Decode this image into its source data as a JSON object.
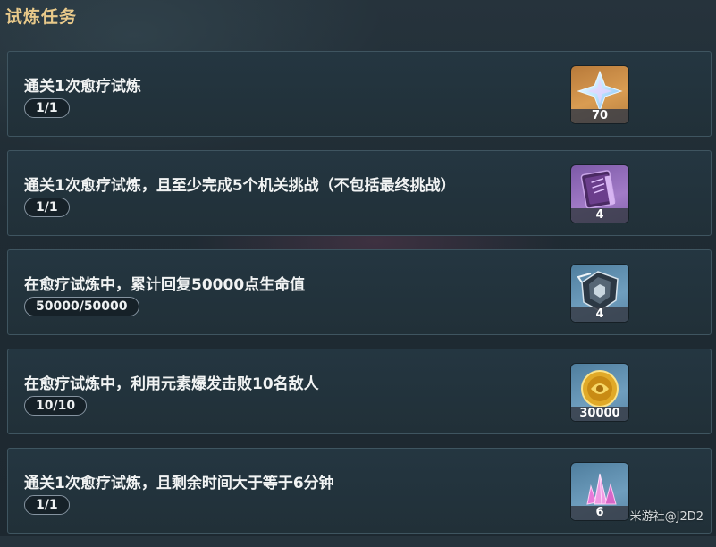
{
  "header": {
    "title": "试炼任务"
  },
  "tasks": [
    {
      "description": "通关1次愈疗试炼",
      "progress": "1/1",
      "reward": {
        "icon": "primogem-icon",
        "count": "70",
        "rarity_color": "#c88a45"
      }
    },
    {
      "description": "通关1次愈疗试炼，且至少完成5个机关挑战（不包括最终挑战）",
      "progress": "1/1",
      "reward": {
        "icon": "hero-wit-book-icon",
        "count": "4",
        "rarity_color": "#9a76c2"
      }
    },
    {
      "description": "在愈疗试炼中，累计回复50000点生命值",
      "progress": "50000/50000",
      "reward": {
        "icon": "mystic-enhancement-ore-icon",
        "count": "4",
        "rarity_color": "#6a97b8"
      }
    },
    {
      "description": "在愈疗试炼中，利用元素爆发击败10名敌人",
      "progress": "10/10",
      "reward": {
        "icon": "mora-coin-icon",
        "count": "30000",
        "rarity_color": "#6a97b8"
      }
    },
    {
      "description": "通关1次愈疗试炼，且剩余时间大于等于6分钟",
      "progress": "1/1",
      "reward": {
        "icon": "pink-crystal-icon",
        "count": "6",
        "rarity_color": "#6a97b8"
      }
    }
  ],
  "watermark": "米游社@J2D2"
}
